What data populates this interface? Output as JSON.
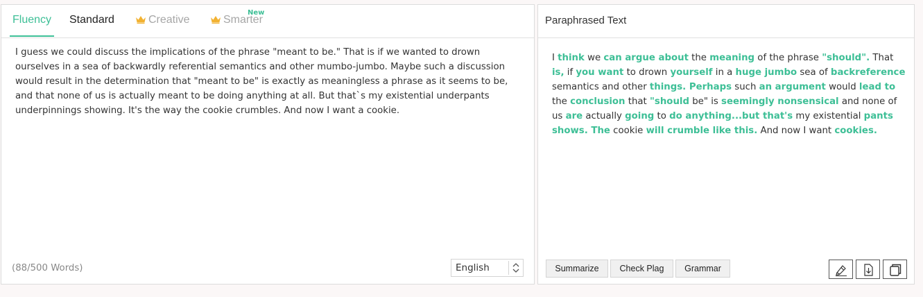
{
  "tabs": [
    {
      "label": "Fluency",
      "state": "active"
    },
    {
      "label": "Standard",
      "state": "normal"
    },
    {
      "label": "Creative",
      "state": "premium"
    },
    {
      "label": "Smarter",
      "state": "premium",
      "badge": "New"
    }
  ],
  "colors": {
    "accent": "#3dbf96",
    "crown": "#f2b232"
  },
  "input": {
    "text": "I guess we could discuss the implications of the phrase \"meant to be.\" That is if we wanted to drown ourselves in a sea of backwardly referential semantics and other mumbo-jumbo. Maybe such a discussion would result in the determination that \"meant to be\" is exactly as meaningless a phrase as it seems to be, and that none of us is actually meant to be doing anything at all. But that`s my existential underpants underpinnings showing. It's the way the cookie crumbles. And now I want a cookie.",
    "word_count": "(88/500 Words)",
    "language": "English"
  },
  "output": {
    "title": "Paraphrased Text",
    "segments": [
      {
        "t": "I ",
        "c": false
      },
      {
        "t": "think",
        "c": true
      },
      {
        "t": " we ",
        "c": false
      },
      {
        "t": "can argue about",
        "c": true
      },
      {
        "t": " the ",
        "c": false
      },
      {
        "t": "meaning",
        "c": true
      },
      {
        "t": " of the phrase ",
        "c": false
      },
      {
        "t": "\"should\".",
        "c": true
      },
      {
        "t": " That ",
        "c": false
      },
      {
        "t": "is,",
        "c": true
      },
      {
        "t": " if ",
        "c": false
      },
      {
        "t": "you want",
        "c": true
      },
      {
        "t": " to drown ",
        "c": false
      },
      {
        "t": "yourself",
        "c": true
      },
      {
        "t": " in a ",
        "c": false
      },
      {
        "t": "huge jumbo",
        "c": true
      },
      {
        "t": " sea of ",
        "c": false
      },
      {
        "t": "backreference",
        "c": true
      },
      {
        "t": " semantics and other ",
        "c": false
      },
      {
        "t": "things. Perhaps",
        "c": true
      },
      {
        "t": " such ",
        "c": false
      },
      {
        "t": "an argument",
        "c": true
      },
      {
        "t": " would ",
        "c": false
      },
      {
        "t": "lead to",
        "c": true
      },
      {
        "t": " the ",
        "c": false
      },
      {
        "t": "conclusion",
        "c": true
      },
      {
        "t": " that ",
        "c": false
      },
      {
        "t": "\"should",
        "c": true
      },
      {
        "t": " be\" is ",
        "c": false
      },
      {
        "t": "seemingly nonsensical",
        "c": true
      },
      {
        "t": " and  none of us ",
        "c": false
      },
      {
        "t": "are",
        "c": true
      },
      {
        "t": " actually ",
        "c": false
      },
      {
        "t": "going",
        "c": true
      },
      {
        "t": " to ",
        "c": false
      },
      {
        "t": "do anything...but that's",
        "c": true
      },
      {
        "t": " my existential ",
        "c": false
      },
      {
        "t": "pants shows. The",
        "c": true
      },
      {
        "t": " cookie ",
        "c": false
      },
      {
        "t": "will crumble like this.",
        "c": true
      },
      {
        "t": " And now I want ",
        "c": false
      },
      {
        "t": "cookies.",
        "c": true
      }
    ]
  },
  "actions": {
    "summarize": "Summarize",
    "check_plag": "Check Plag",
    "grammar": "Grammar"
  },
  "icons": [
    "crown-icon",
    "highlighter-icon",
    "download-icon",
    "copy-icon",
    "select-arrows-icon"
  ]
}
